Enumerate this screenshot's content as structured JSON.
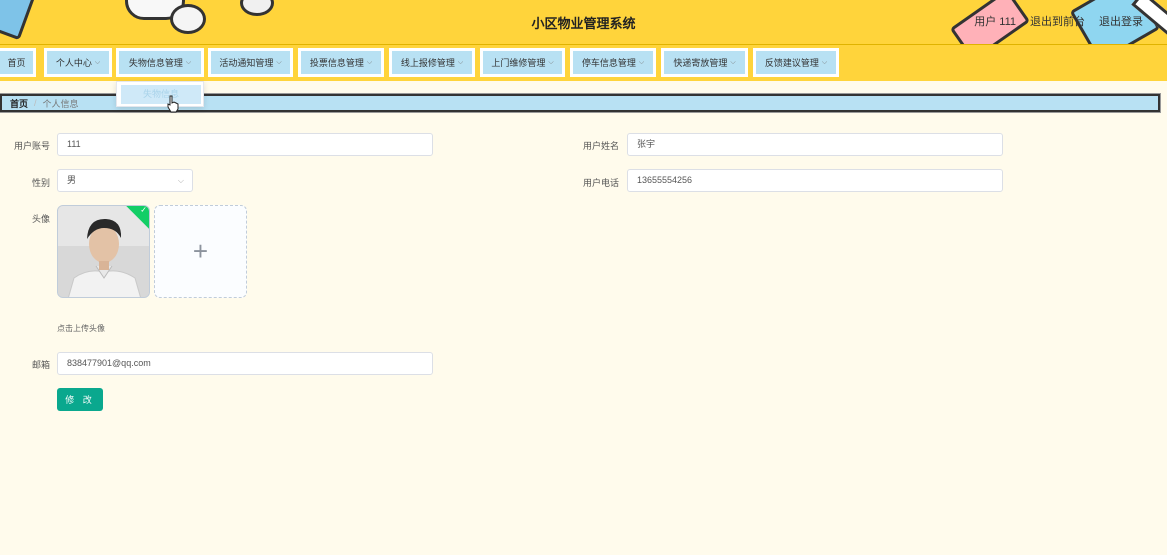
{
  "header": {
    "title": "小区物业管理系统",
    "user": "用户 111",
    "front_link": "退出到前台",
    "logout": "退出登录"
  },
  "nav": {
    "items": [
      {
        "label": "首页",
        "has_dropdown": false
      },
      {
        "label": "个人中心",
        "has_dropdown": true
      },
      {
        "label": "失物信息管理",
        "has_dropdown": true
      },
      {
        "label": "活动通知管理",
        "has_dropdown": true
      },
      {
        "label": "投票信息管理",
        "has_dropdown": true
      },
      {
        "label": "线上报修管理",
        "has_dropdown": true
      },
      {
        "label": "上门维修管理",
        "has_dropdown": true
      },
      {
        "label": "停车信息管理",
        "has_dropdown": true
      },
      {
        "label": "快递寄放管理",
        "has_dropdown": true
      },
      {
        "label": "反馈建议管理",
        "has_dropdown": true
      }
    ],
    "dropdown_open": {
      "menu": "失物信息管理",
      "items": [
        "失物信息"
      ]
    }
  },
  "breadcrumb": {
    "home": "首页",
    "separator": "/",
    "current": "个人信息"
  },
  "form": {
    "account_label": "用户账号",
    "account_value": "111",
    "name_label": "用户姓名",
    "name_value": "张宇",
    "gender_label": "性别",
    "gender_value": "男",
    "phone_label": "用户电话",
    "phone_value": "13655554256",
    "avatar_label": "头像",
    "upload_hint": "点击上传头像",
    "email_label": "邮箱",
    "email_value": "838477901@qq.com",
    "submit_label": "修 改"
  },
  "colors": {
    "header_bg": "#ffd43b",
    "nav_item_bg": "#b8e1f3",
    "page_bg": "#fffbec",
    "button_bg": "#0aa88e",
    "success": "#13ce66"
  }
}
